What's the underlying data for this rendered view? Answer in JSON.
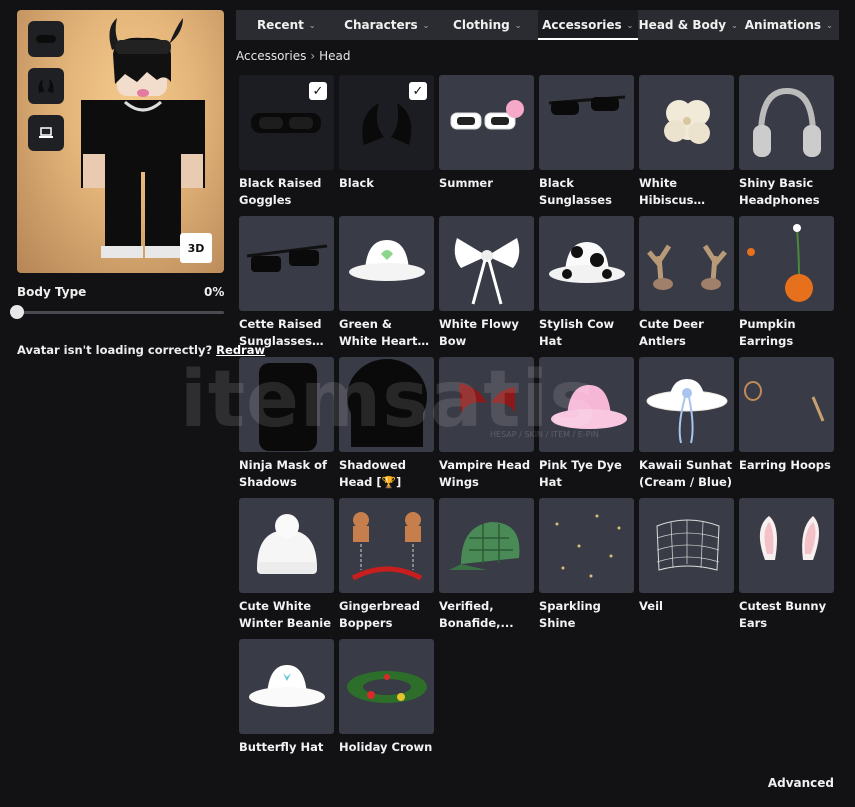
{
  "avatar": {
    "view_3d_label": "3D"
  },
  "body_type": {
    "label": "Body Type",
    "value": "0%",
    "level": 0
  },
  "loading": {
    "message": "Avatar isn't loading correctly?",
    "link": "Redraw"
  },
  "tabs": [
    {
      "label": "Recent",
      "active": false
    },
    {
      "label": "Characters",
      "active": false
    },
    {
      "label": "Clothing",
      "active": false
    },
    {
      "label": "Accessories",
      "active": true
    },
    {
      "label": "Head & Body",
      "active": false
    },
    {
      "label": "Animations",
      "active": false
    }
  ],
  "breadcrumb": {
    "parent": "Accessories",
    "current": "Head"
  },
  "items": [
    {
      "name": "Black Raised Goggles",
      "equipped": true,
      "icon": "goggles-icon"
    },
    {
      "name": "Black",
      "equipped": true,
      "icon": "black-horns-icon"
    },
    {
      "name": "Summer",
      "equipped": false,
      "icon": "summer-glasses-icon"
    },
    {
      "name": "Black Sunglasses",
      "equipped": false,
      "icon": "sunglasses-icon"
    },
    {
      "name": "White Hibiscus Flower",
      "equipped": false,
      "icon": "flower-icon"
    },
    {
      "name": "Shiny Basic Headphones",
      "equipped": false,
      "icon": "headphones-icon"
    },
    {
      "name": "Cette Raised Sunglasses In...",
      "equipped": false,
      "icon": "raised-sunglasses-icon"
    },
    {
      "name": "Green & White Heart Wave Ha...",
      "equipped": false,
      "icon": "bucket-hat-icon"
    },
    {
      "name": "White Flowy Bow",
      "equipped": false,
      "icon": "bow-icon"
    },
    {
      "name": "Stylish Cow Hat",
      "equipped": false,
      "icon": "cow-hat-icon"
    },
    {
      "name": "Cute Deer Antlers",
      "equipped": false,
      "icon": "antlers-icon"
    },
    {
      "name": "Pumpkin Earrings",
      "equipped": false,
      "icon": "pumpkin-icon"
    },
    {
      "name": "Ninja Mask of Shadows",
      "equipped": false,
      "icon": "ninja-mask-icon"
    },
    {
      "name": "Shadowed Head [🏆]",
      "equipped": false,
      "icon": "shadowed-head-icon"
    },
    {
      "name": "Vampire Head Wings",
      "equipped": false,
      "icon": "wings-icon"
    },
    {
      "name": "Pink Tye Dye Hat",
      "equipped": false,
      "icon": "pink-hat-icon"
    },
    {
      "name": "Kawaii Sunhat (Cream / Blue)",
      "equipped": false,
      "icon": "sunhat-icon"
    },
    {
      "name": "Earring Hoops",
      "equipped": false,
      "icon": "hoops-icon"
    },
    {
      "name": "Cute White Winter Beanie",
      "equipped": false,
      "icon": "beanie-icon"
    },
    {
      "name": "Gingerbread Boppers",
      "equipped": false,
      "icon": "gingerbread-icon"
    },
    {
      "name": "Verified, Bonafide,...",
      "equipped": false,
      "icon": "green-cap-icon"
    },
    {
      "name": "Sparkling Shine",
      "equipped": false,
      "icon": "sparkle-icon"
    },
    {
      "name": "Veil",
      "equipped": false,
      "icon": "veil-icon"
    },
    {
      "name": "Cutest Bunny Ears",
      "equipped": false,
      "icon": "bunny-ears-icon"
    },
    {
      "name": "Butterfly Hat",
      "equipped": false,
      "icon": "butterfly-hat-icon"
    },
    {
      "name": "Holiday Crown",
      "equipped": false,
      "icon": "holiday-crown-icon"
    }
  ],
  "footer": {
    "advanced_label": "Advanced"
  },
  "watermark": {
    "brand": "itemsatis",
    "tagline": "HESAP / SKIN / ITEM / E-PIN"
  }
}
